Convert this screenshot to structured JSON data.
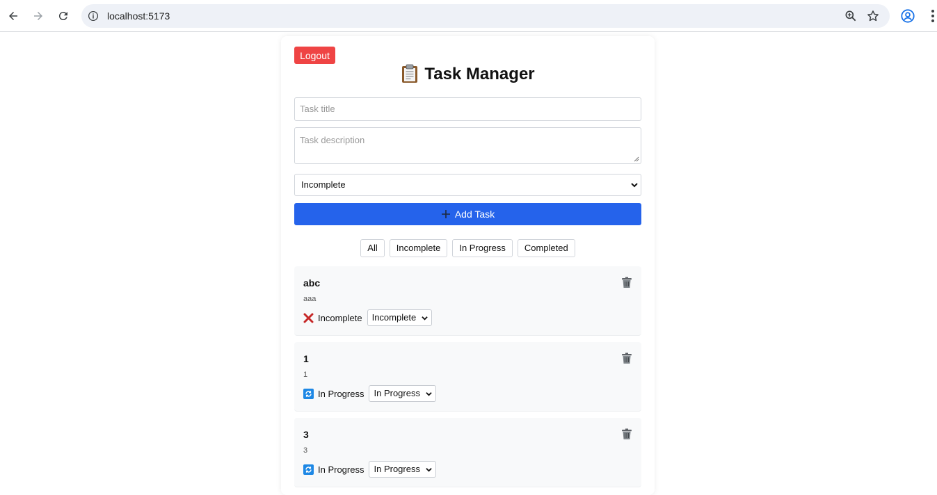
{
  "browser": {
    "url": "localhost:5173"
  },
  "app": {
    "logout_label": "Logout",
    "title": "Task Manager",
    "form": {
      "title_placeholder": "Task title",
      "description_placeholder": "Task description",
      "status_selected": "Incomplete",
      "add_label": "Add Task"
    },
    "filters": [
      "All",
      "Incomplete",
      "In Progress",
      "Completed"
    ],
    "tasks": [
      {
        "title": "abc",
        "description": "aaa",
        "status": "Incomplete",
        "status_icon": "cross-mark-icon",
        "select_value": "Incomplete"
      },
      {
        "title": "1",
        "description": "1",
        "status": "In Progress",
        "status_icon": "refresh-icon",
        "select_value": "In Progress"
      },
      {
        "title": "3",
        "description": "3",
        "status": "In Progress",
        "status_icon": "refresh-icon",
        "select_value": "In Progress"
      }
    ]
  },
  "colors": {
    "logout": "#ef4444",
    "primary": "#2563eb",
    "task_bg": "#f8f9fa"
  }
}
